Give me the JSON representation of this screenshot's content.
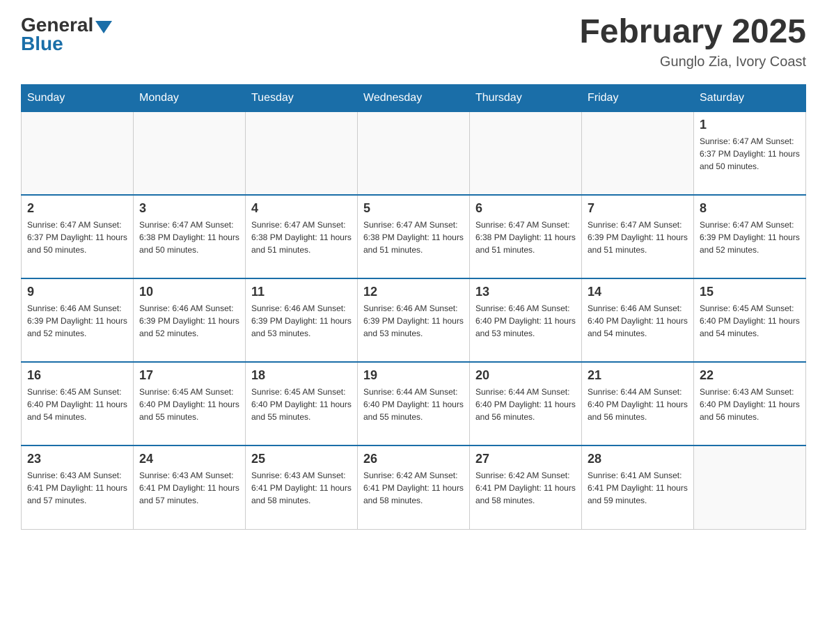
{
  "header": {
    "logo_general": "General",
    "logo_blue": "Blue",
    "month_title": "February 2025",
    "location": "Gunglo Zia, Ivory Coast"
  },
  "days_of_week": [
    "Sunday",
    "Monday",
    "Tuesday",
    "Wednesday",
    "Thursday",
    "Friday",
    "Saturday"
  ],
  "weeks": [
    [
      {
        "day": "",
        "info": ""
      },
      {
        "day": "",
        "info": ""
      },
      {
        "day": "",
        "info": ""
      },
      {
        "day": "",
        "info": ""
      },
      {
        "day": "",
        "info": ""
      },
      {
        "day": "",
        "info": ""
      },
      {
        "day": "1",
        "info": "Sunrise: 6:47 AM\nSunset: 6:37 PM\nDaylight: 11 hours\nand 50 minutes."
      }
    ],
    [
      {
        "day": "2",
        "info": "Sunrise: 6:47 AM\nSunset: 6:37 PM\nDaylight: 11 hours\nand 50 minutes."
      },
      {
        "day": "3",
        "info": "Sunrise: 6:47 AM\nSunset: 6:38 PM\nDaylight: 11 hours\nand 50 minutes."
      },
      {
        "day": "4",
        "info": "Sunrise: 6:47 AM\nSunset: 6:38 PM\nDaylight: 11 hours\nand 51 minutes."
      },
      {
        "day": "5",
        "info": "Sunrise: 6:47 AM\nSunset: 6:38 PM\nDaylight: 11 hours\nand 51 minutes."
      },
      {
        "day": "6",
        "info": "Sunrise: 6:47 AM\nSunset: 6:38 PM\nDaylight: 11 hours\nand 51 minutes."
      },
      {
        "day": "7",
        "info": "Sunrise: 6:47 AM\nSunset: 6:39 PM\nDaylight: 11 hours\nand 51 minutes."
      },
      {
        "day": "8",
        "info": "Sunrise: 6:47 AM\nSunset: 6:39 PM\nDaylight: 11 hours\nand 52 minutes."
      }
    ],
    [
      {
        "day": "9",
        "info": "Sunrise: 6:46 AM\nSunset: 6:39 PM\nDaylight: 11 hours\nand 52 minutes."
      },
      {
        "day": "10",
        "info": "Sunrise: 6:46 AM\nSunset: 6:39 PM\nDaylight: 11 hours\nand 52 minutes."
      },
      {
        "day": "11",
        "info": "Sunrise: 6:46 AM\nSunset: 6:39 PM\nDaylight: 11 hours\nand 53 minutes."
      },
      {
        "day": "12",
        "info": "Sunrise: 6:46 AM\nSunset: 6:39 PM\nDaylight: 11 hours\nand 53 minutes."
      },
      {
        "day": "13",
        "info": "Sunrise: 6:46 AM\nSunset: 6:40 PM\nDaylight: 11 hours\nand 53 minutes."
      },
      {
        "day": "14",
        "info": "Sunrise: 6:46 AM\nSunset: 6:40 PM\nDaylight: 11 hours\nand 54 minutes."
      },
      {
        "day": "15",
        "info": "Sunrise: 6:45 AM\nSunset: 6:40 PM\nDaylight: 11 hours\nand 54 minutes."
      }
    ],
    [
      {
        "day": "16",
        "info": "Sunrise: 6:45 AM\nSunset: 6:40 PM\nDaylight: 11 hours\nand 54 minutes."
      },
      {
        "day": "17",
        "info": "Sunrise: 6:45 AM\nSunset: 6:40 PM\nDaylight: 11 hours\nand 55 minutes."
      },
      {
        "day": "18",
        "info": "Sunrise: 6:45 AM\nSunset: 6:40 PM\nDaylight: 11 hours\nand 55 minutes."
      },
      {
        "day": "19",
        "info": "Sunrise: 6:44 AM\nSunset: 6:40 PM\nDaylight: 11 hours\nand 55 minutes."
      },
      {
        "day": "20",
        "info": "Sunrise: 6:44 AM\nSunset: 6:40 PM\nDaylight: 11 hours\nand 56 minutes."
      },
      {
        "day": "21",
        "info": "Sunrise: 6:44 AM\nSunset: 6:40 PM\nDaylight: 11 hours\nand 56 minutes."
      },
      {
        "day": "22",
        "info": "Sunrise: 6:43 AM\nSunset: 6:40 PM\nDaylight: 11 hours\nand 56 minutes."
      }
    ],
    [
      {
        "day": "23",
        "info": "Sunrise: 6:43 AM\nSunset: 6:41 PM\nDaylight: 11 hours\nand 57 minutes."
      },
      {
        "day": "24",
        "info": "Sunrise: 6:43 AM\nSunset: 6:41 PM\nDaylight: 11 hours\nand 57 minutes."
      },
      {
        "day": "25",
        "info": "Sunrise: 6:43 AM\nSunset: 6:41 PM\nDaylight: 11 hours\nand 58 minutes."
      },
      {
        "day": "26",
        "info": "Sunrise: 6:42 AM\nSunset: 6:41 PM\nDaylight: 11 hours\nand 58 minutes."
      },
      {
        "day": "27",
        "info": "Sunrise: 6:42 AM\nSunset: 6:41 PM\nDaylight: 11 hours\nand 58 minutes."
      },
      {
        "day": "28",
        "info": "Sunrise: 6:41 AM\nSunset: 6:41 PM\nDaylight: 11 hours\nand 59 minutes."
      },
      {
        "day": "",
        "info": ""
      }
    ]
  ]
}
